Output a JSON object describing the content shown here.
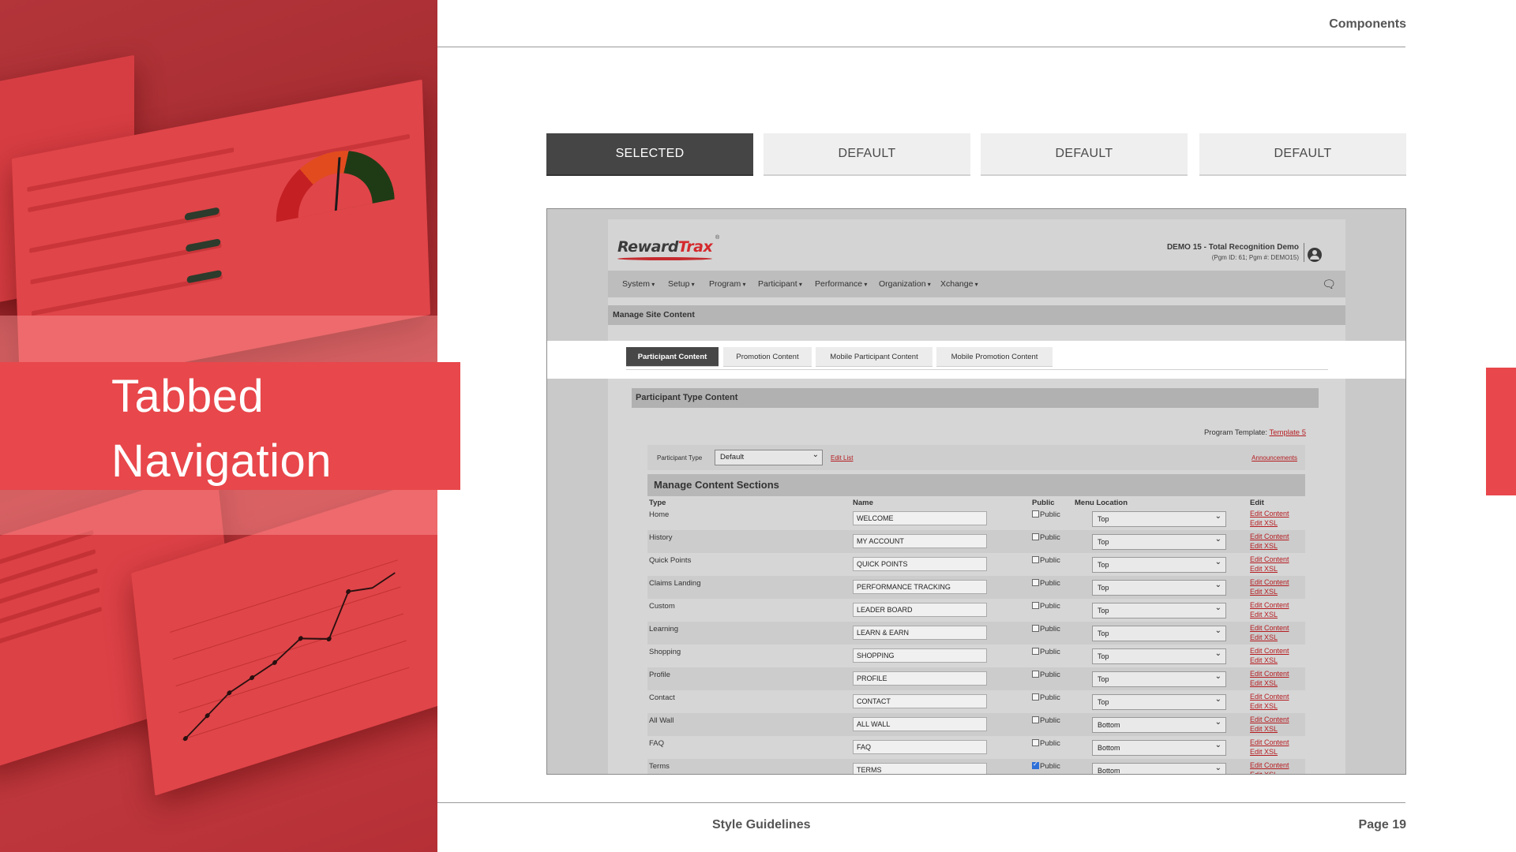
{
  "header": {
    "section": "Components"
  },
  "hero": {
    "line1": "Tabbed",
    "line2": "Navigation"
  },
  "tabs": [
    {
      "label": "SELECTED",
      "state": "selected"
    },
    {
      "label": "DEFAULT",
      "state": "default"
    },
    {
      "label": "DEFAULT",
      "state": "default"
    },
    {
      "label": "DEFAULT",
      "state": "default"
    }
  ],
  "app": {
    "logo": {
      "part1": "Reward",
      "part2": "Trax",
      "reg": "®"
    },
    "program_name": "DEMO 15 - Total Recognition Demo",
    "program_id": "(Pgm ID: 61; Pgm #: DEMO15)",
    "nav": [
      "System",
      "Setup",
      "Program",
      "Participant",
      "Performance",
      "Organization",
      "Xchange"
    ],
    "section_title": "Manage Site Content",
    "content_tabs": [
      {
        "label": "Participant Content",
        "selected": true
      },
      {
        "label": "Promotion Content",
        "selected": false
      },
      {
        "label": "Mobile Participant Content",
        "selected": false
      },
      {
        "label": "Mobile Promotion Content",
        "selected": false
      }
    ],
    "panel_title": "Participant Type Content",
    "template_label": "Program Template:",
    "template_link": "Template 5",
    "filter": {
      "label": "Participant Type",
      "value": "Default",
      "edit_list": "Edit List",
      "announcements": "Announcements"
    },
    "table_title": "Manage Content Sections",
    "columns": {
      "type": "Type",
      "name": "Name",
      "public": "Public",
      "menu_location": "Menu Location",
      "edit": "Edit"
    },
    "public_label": "Public",
    "edit_content": "Edit Content",
    "edit_xsl": "Edit XSL",
    "rows": [
      {
        "type": "Home",
        "name": "WELCOME",
        "public": false,
        "location": "Top"
      },
      {
        "type": "History",
        "name": "MY ACCOUNT",
        "public": false,
        "location": "Top"
      },
      {
        "type": "Quick Points",
        "name": "QUICK POINTS",
        "public": false,
        "location": "Top"
      },
      {
        "type": "Claims Landing",
        "name": "PERFORMANCE TRACKING",
        "public": false,
        "location": "Top"
      },
      {
        "type": "Custom",
        "name": "LEADER BOARD",
        "public": false,
        "location": "Top"
      },
      {
        "type": "Learning",
        "name": "LEARN & EARN",
        "public": false,
        "location": "Top"
      },
      {
        "type": "Shopping",
        "name": "SHOPPING",
        "public": false,
        "location": "Top"
      },
      {
        "type": "Profile",
        "name": "PROFILE",
        "public": false,
        "location": "Top"
      },
      {
        "type": "Contact",
        "name": "CONTACT",
        "public": false,
        "location": "Top"
      },
      {
        "type": "All Wall",
        "name": "ALL WALL",
        "public": false,
        "location": "Bottom"
      },
      {
        "type": "FAQ",
        "name": "FAQ",
        "public": false,
        "location": "Bottom"
      },
      {
        "type": "Terms",
        "name": "TERMS",
        "public": true,
        "location": "Bottom"
      }
    ]
  },
  "footer": {
    "center": "Style Guidelines",
    "page": "Page 19"
  },
  "colors": {
    "brand_red": "#e8474b",
    "selected_tab": "#454545",
    "default_tab": "#efefef",
    "link_red": "#b51c20"
  }
}
